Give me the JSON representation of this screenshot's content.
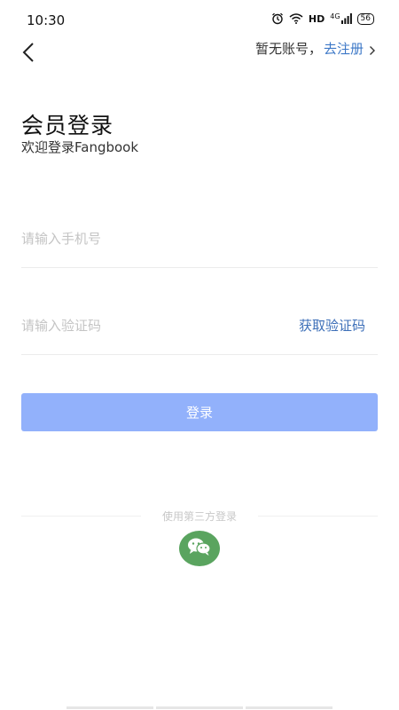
{
  "status_bar": {
    "time": "10:30",
    "network_label": "HD",
    "signal_label": "4G",
    "battery_level": "56",
    "icons": [
      "alarm-icon",
      "wifi-icon",
      "signal-icon",
      "battery-icon"
    ]
  },
  "nav": {
    "back_icon": "back-arrow-icon",
    "register_prompt": "暂无账号，",
    "register_link": "去注册"
  },
  "header": {
    "title": "会员登录",
    "subtitle": "欢迎登录Fangbook"
  },
  "form": {
    "phone_placeholder": "请输入手机号",
    "phone_value": "",
    "code_placeholder": "请输入验证码",
    "code_value": "",
    "get_code_label": "获取验证码",
    "login_label": "登录"
  },
  "third_party": {
    "label": "使用第三方登录",
    "wechat_icon": "wechat-icon"
  },
  "colors": {
    "accent_link": "#3d78c7",
    "login_button": "#92b1fb",
    "wechat_green": "#5aa45f",
    "placeholder": "#c4c4c4"
  }
}
